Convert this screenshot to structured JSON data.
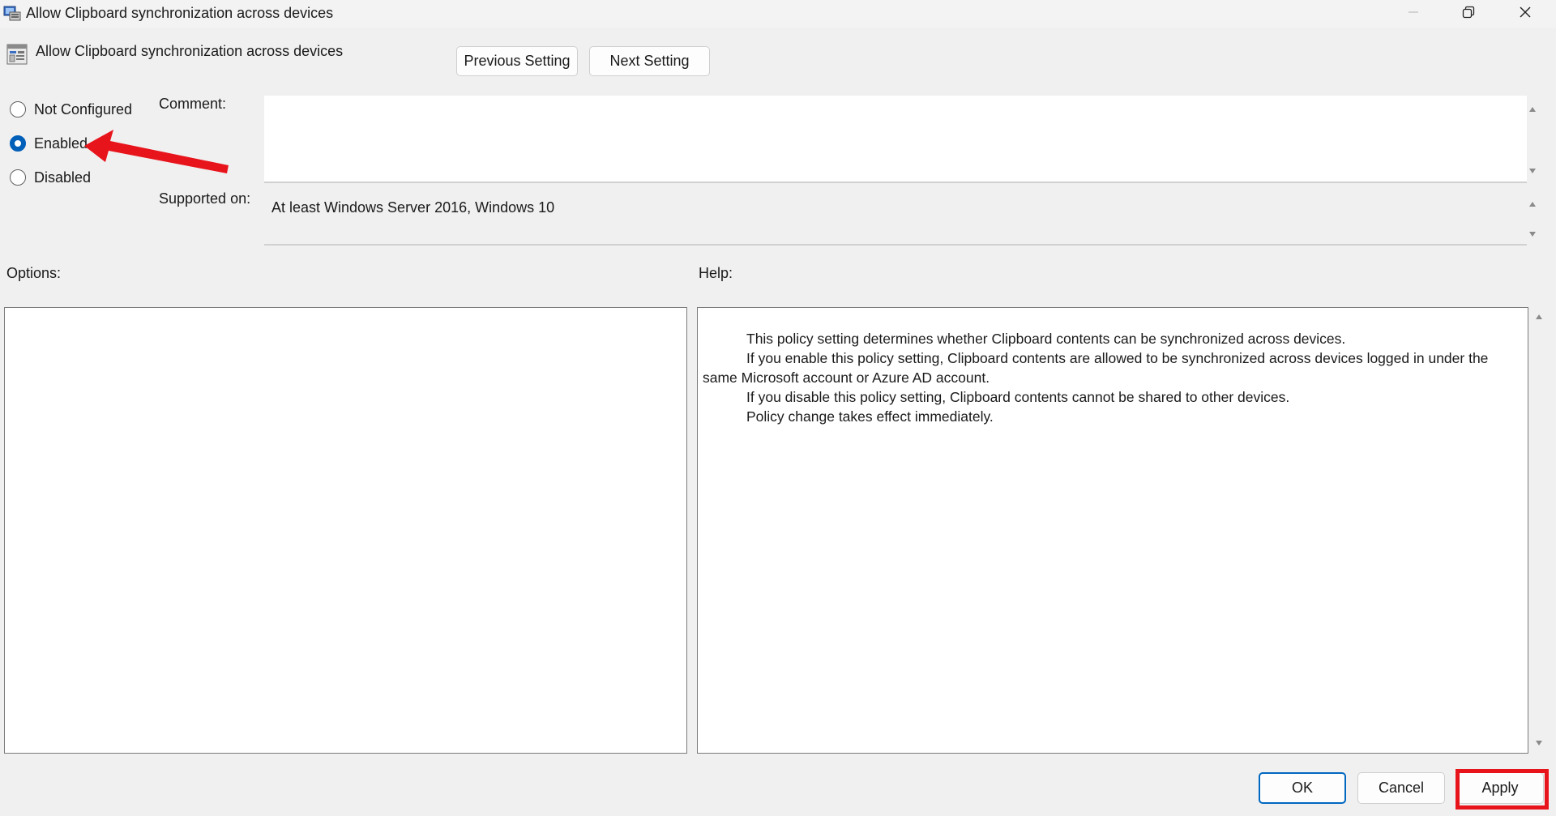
{
  "window": {
    "title": "Allow Clipboard synchronization across devices",
    "controls": {
      "minimize": "minimize-icon",
      "maximize": "restore-icon",
      "close": "close-icon"
    }
  },
  "header": {
    "setting_name": "Allow Clipboard synchronization across devices",
    "previous_label": "Previous Setting",
    "next_label": "Next Setting"
  },
  "state": {
    "options": [
      {
        "label": "Not Configured",
        "checked": false
      },
      {
        "label": "Enabled",
        "checked": true
      },
      {
        "label": "Disabled",
        "checked": false
      }
    ]
  },
  "comment": {
    "label": "Comment:",
    "value": ""
  },
  "supported": {
    "label": "Supported on:",
    "value": "At least Windows Server 2016, Windows 10"
  },
  "options_panel": {
    "label": "Options:"
  },
  "help_panel": {
    "label": "Help:",
    "lines": [
      "This policy setting determines whether Clipboard contents can be synchronized across devices.",
      "If you enable this policy setting, Clipboard contents are allowed to be synchronized across devices logged in under the",
      "same Microsoft account or Azure AD account.",
      "If you disable this policy setting, Clipboard contents cannot be shared to other devices.",
      "Policy change takes effect immediately."
    ]
  },
  "footer": {
    "ok_label": "OK",
    "cancel_label": "Cancel",
    "apply_label": "Apply"
  },
  "colors": {
    "accent": "#005fb8",
    "annotation_red": "#e8141c",
    "background": "#f0f0f0"
  }
}
